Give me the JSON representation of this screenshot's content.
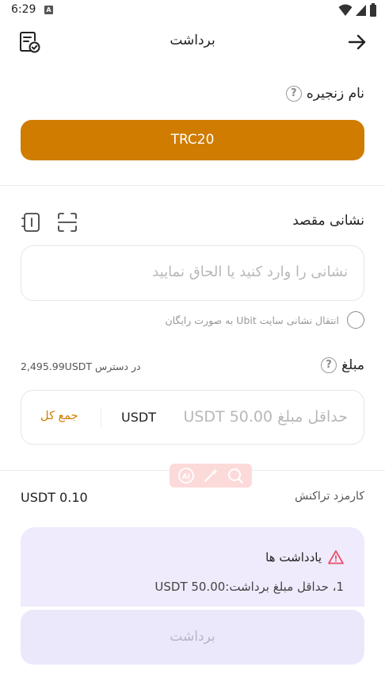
{
  "status_bar": {
    "time": "6:29",
    "notif_glyph": "A"
  },
  "header": {
    "title": "برداشت"
  },
  "chain": {
    "label": "نام زنجیره",
    "help": "?",
    "selected": "TRC20"
  },
  "address": {
    "label": "نشانی مقصد",
    "placeholder": "نشانی را وارد کنید یا الحاق نمایید",
    "free_transfer_text": "انتقال نشانی سایت Ubit به صورت رایگان"
  },
  "amount": {
    "label": "مبلغ",
    "help": "?",
    "available_prefix": "در دسترس",
    "available_value": "2,495.99USDT",
    "placeholder": "حداقل مبلغ 50.00 USDT",
    "unit": "USDT",
    "max_label": "جمع کل"
  },
  "fee": {
    "label": "کارمزد تراکنش",
    "value": "USDT 0.10"
  },
  "notes": {
    "title": "یادداشت ها",
    "items": [
      "1، حداقل مبلغ برداشت:50.00 USDT"
    ]
  },
  "submit": {
    "label": "برداشت"
  },
  "colors": {
    "accent": "#d07c00",
    "notes_bg": "#efebfc",
    "disabled_bg": "#ece8fb",
    "warning": "#e8506a"
  }
}
